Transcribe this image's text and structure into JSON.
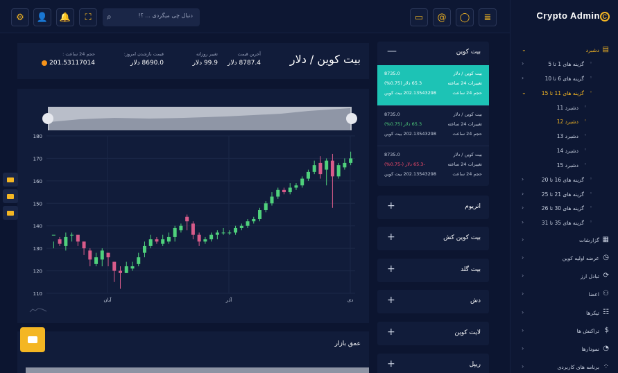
{
  "search": {
    "placeholder": "دنبال چی میگردی ... ؟!"
  },
  "brand": {
    "name": "Crypto Admin",
    "mark": "C"
  },
  "sidebar": {
    "items": [
      {
        "label": "دشبرد",
        "icon": "dashboard-icon",
        "level": 0,
        "active": true
      },
      {
        "label": "گزینه های 1 تا 5",
        "level": 1
      },
      {
        "label": "گزینه های 6 تا 10",
        "level": 1
      },
      {
        "label": "گزینه های 11 تا 15",
        "level": 1,
        "active": true
      },
      {
        "label": "دشبرد 11",
        "level": 2
      },
      {
        "label": "دشبرد 12",
        "level": 2,
        "active": true
      },
      {
        "label": "دشبرد 13",
        "level": 2
      },
      {
        "label": "دشبرد 14",
        "level": 2
      },
      {
        "label": "دشبرد 15",
        "level": 2
      },
      {
        "label": "گزینه های 16 تا 20",
        "level": 1
      },
      {
        "label": "گزینه های 21 تا 25",
        "level": 1
      },
      {
        "label": "گزینه های 30 تا 26",
        "level": 1
      },
      {
        "label": "گزینه های 35 تا 31",
        "level": 1
      },
      {
        "label": "گزارشات",
        "icon": "report-icon",
        "level": 0
      },
      {
        "label": "عرضه اولیه کوین",
        "icon": "clock-icon",
        "level": 0
      },
      {
        "label": "تبادل ارز",
        "icon": "exchange-icon",
        "level": 0
      },
      {
        "label": "اعضا",
        "icon": "users-icon",
        "level": 0
      },
      {
        "label": "تیکرها",
        "icon": "sliders-icon",
        "level": 0
      },
      {
        "label": "تراکنش ها",
        "icon": "dollar-icon",
        "level": 0
      },
      {
        "label": "نمودارها",
        "icon": "chart-pie-icon",
        "level": 0
      },
      {
        "label": "برنامه های کاربردی",
        "icon": "apps-icon",
        "level": 0
      }
    ]
  },
  "ticker": {
    "title": "بیت کوین / دلار",
    "stats": [
      {
        "label": "آخرین قیمت",
        "value": "8787.4 دلار"
      },
      {
        "label": "تغییر روزانه",
        "value": "99.9 دلار"
      },
      {
        "label": "قیمت بازشدن امروز:",
        "value": "8690.0 دلار"
      },
      {
        "label": "حجم 24 ساعت :",
        "value": "201.53117014"
      }
    ]
  },
  "depth": {
    "title": "عمق بازار"
  },
  "coins": {
    "open": {
      "name": "بیت کوین",
      "sign": "—"
    },
    "rows": [
      {
        "pair": "بیت کوین / دلار",
        "price": "8735.0",
        "change_label": "تغییرات 24 ساعته",
        "change": "65.3 دلار (0.75%)",
        "vol_label": "حجم 24 ساعت",
        "vol": "202.13543298 بیت کوین",
        "active": true,
        "neg": false
      },
      {
        "pair": "بیت کوین / دلار",
        "price": "8735.0",
        "change_label": "تغییرات 24 ساعته",
        "change": "65.3 دلار (0.75%)",
        "vol_label": "حجم 24 ساعت",
        "vol": "202.13543298 بیت کوین",
        "active": false,
        "neg": false
      },
      {
        "pair": "بیت کوین / دلار",
        "price": "8735.0",
        "change_label": "تغییرات 24 ساعته",
        "change": "-65.3 دلار (-0.75%)",
        "vol_label": "حجم 24 ساعت",
        "vol": "202.13543298 بیت کوین",
        "active": false,
        "neg": true
      }
    ],
    "others": [
      {
        "name": "اتریوم",
        "sign": "+"
      },
      {
        "name": "بیت کوین کش",
        "sign": "+"
      },
      {
        "name": "بیت گلد",
        "sign": "+"
      },
      {
        "name": "دش",
        "sign": "+"
      },
      {
        "name": "لایت کوین",
        "sign": "+"
      },
      {
        "name": "ریپل",
        "sign": "+"
      }
    ]
  },
  "chart_data": {
    "type": "candlestick",
    "ylim": [
      110,
      180
    ],
    "yticks": [
      110,
      120,
      130,
      140,
      150,
      160,
      170,
      180
    ],
    "xticks": [
      "آبان",
      "آذر",
      "دی"
    ],
    "colors": {
      "up": "#4fd17c",
      "down": "#d85b8a"
    },
    "candles": [
      [
        136,
        136,
        133,
        130
      ],
      [
        134,
        132,
        135,
        131
      ],
      [
        131,
        135,
        137,
        129
      ],
      [
        136,
        136,
        137,
        133
      ],
      [
        136,
        133,
        135,
        131
      ],
      [
        133,
        130,
        133,
        127
      ],
      [
        129,
        125,
        130,
        122
      ],
      [
        123,
        126,
        128,
        122
      ],
      [
        125,
        129,
        130,
        122
      ],
      [
        128,
        126,
        128,
        122
      ],
      [
        124,
        120,
        124,
        115
      ],
      [
        120,
        119,
        122,
        112
      ],
      [
        119,
        122,
        124,
        119
      ],
      [
        121,
        122,
        124,
        120
      ],
      [
        123,
        126,
        128,
        122
      ],
      [
        128,
        131,
        133,
        126
      ],
      [
        131,
        134,
        136,
        130
      ],
      [
        134,
        133,
        135,
        132
      ],
      [
        132,
        134,
        136,
        131
      ],
      [
        133,
        135,
        137,
        132
      ],
      [
        135,
        139,
        140,
        133
      ],
      [
        138,
        140,
        141,
        137
      ],
      [
        144,
        142,
        145,
        138
      ],
      [
        141,
        136,
        142,
        134
      ],
      [
        136,
        133,
        137,
        131
      ],
      [
        133,
        134,
        135,
        132
      ],
      [
        134,
        136,
        137,
        133
      ],
      [
        136,
        137,
        138,
        134
      ],
      [
        137,
        137,
        139,
        136
      ],
      [
        137,
        137,
        138,
        136
      ],
      [
        137,
        139,
        140,
        136
      ],
      [
        139,
        140,
        141,
        138
      ],
      [
        140,
        142,
        143,
        139
      ],
      [
        142,
        143,
        144,
        141
      ],
      [
        143,
        147,
        148,
        142
      ],
      [
        147,
        150,
        151,
        146
      ],
      [
        150,
        153,
        155,
        149
      ],
      [
        153,
        156,
        157,
        152
      ],
      [
        156,
        155,
        157,
        154
      ],
      [
        155,
        157,
        159,
        154
      ],
      [
        157,
        158,
        159,
        156
      ],
      [
        158,
        161,
        162,
        157
      ],
      [
        161,
        164,
        165,
        160
      ],
      [
        164,
        167,
        169,
        163
      ],
      [
        168,
        163,
        171,
        161
      ],
      [
        165,
        169,
        170,
        158
      ],
      [
        169,
        162,
        172,
        148
      ],
      [
        162,
        167,
        168,
        161
      ],
      [
        166,
        168,
        170,
        165
      ],
      [
        168,
        170,
        173,
        167
      ]
    ]
  }
}
